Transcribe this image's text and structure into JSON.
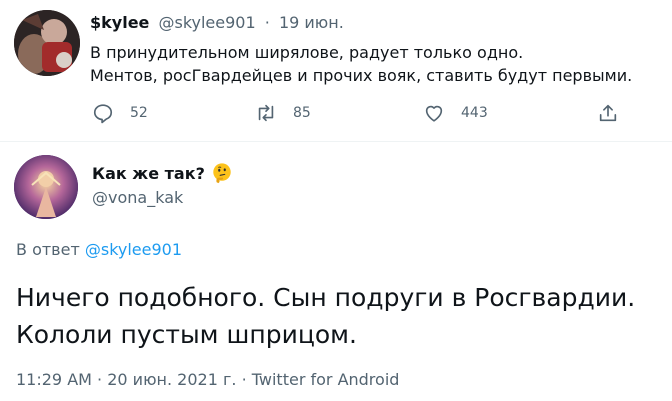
{
  "tweet": {
    "name": "$kylee",
    "handle": "@skylee901",
    "dot": "·",
    "date": "19 июн.",
    "line1": "В принудительном ширялове, радует только одно.",
    "line2": "Ментов, росГвардейцев и прочих вояк, ставить будут первыми.",
    "actions": {
      "replies": "52",
      "retweets": "85",
      "likes": "443"
    }
  },
  "reply": {
    "name": "Как же так?",
    "emoji": "thinking-face-emoji",
    "handle": "@vona_kak",
    "reply_prefix": "В ответ",
    "reply_to": "@skylee901",
    "line1": "Ничего подобного. Сын подруги в Росгвардии.",
    "line2": "Кололи пустым шприцом.",
    "time": "11:29 AM",
    "date": "20 июн. 2021 г.",
    "source": "Twitter for Android",
    "sep": "·"
  },
  "colors": {
    "text": "#0f1419",
    "secondary": "#536471",
    "link": "#1d9bf0",
    "divider": "#eff3f4"
  }
}
